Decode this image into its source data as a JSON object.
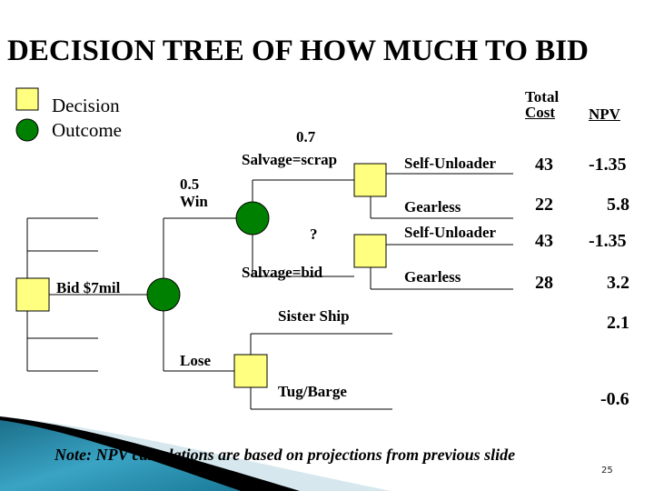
{
  "title": "DECISION TREE OF HOW MUCH TO BID",
  "legend": {
    "decision_label": "Decision",
    "outcome_label": "Outcome",
    "decision_color": "#ffff80",
    "outcome_color": "#008000"
  },
  "columns": {
    "total_cost_line1": "Total",
    "total_cost_line2": "Cost",
    "npv": "NPV"
  },
  "tree": {
    "root_branch_label": "Bid $7mil",
    "win_probability": "0.5",
    "win_label": "Win",
    "lose_label": "Lose",
    "scrap_probability": "0.7",
    "scrap_label": "Salvage=scrap",
    "bid_probability": "?",
    "bid_label": "Salvage=bid",
    "scrap_options": [
      {
        "label": "Self-Unloader",
        "total_cost": "43",
        "npv": "-1.35"
      },
      {
        "label": "Gearless",
        "total_cost": "22",
        "npv": "5.8"
      }
    ],
    "bid_options": [
      {
        "label": "Self-Unloader",
        "total_cost": "43",
        "npv": "-1.35"
      },
      {
        "label": "Gearless",
        "total_cost": "28",
        "npv": "3.2"
      }
    ],
    "lose_options": [
      {
        "label": "Sister Ship",
        "npv": "2.1"
      },
      {
        "label": "Tug/Barge",
        "npv": "-0.6"
      }
    ]
  },
  "note": "Note: NPV calculations are based on projections from previous slide",
  "page_number": "25"
}
